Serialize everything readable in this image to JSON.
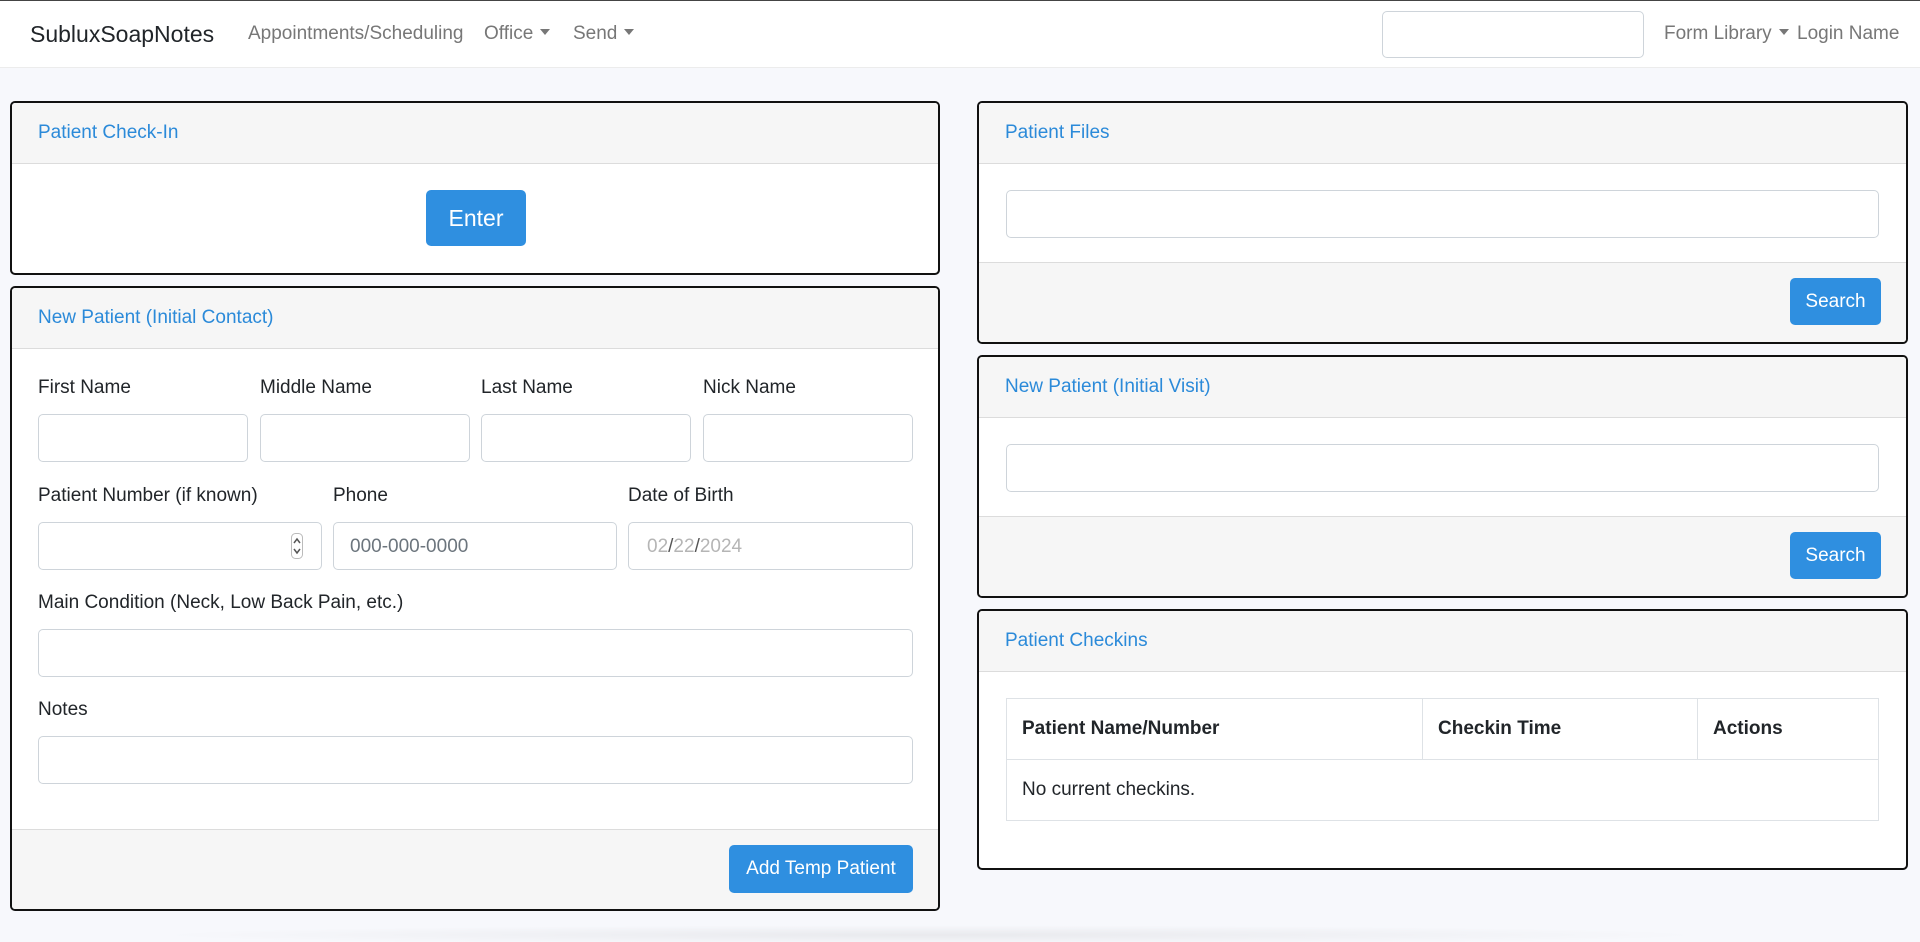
{
  "navbar": {
    "brand": "SubluxSoapNotes",
    "links": {
      "appointments": "Appointments/Scheduling",
      "office": "Office",
      "send": "Send",
      "form_library": "Form Library",
      "login": "Login Name"
    },
    "search_value": ""
  },
  "checkin_card": {
    "title": "Patient Check-In",
    "enter_button": "Enter"
  },
  "new_patient_contact": {
    "title": "New Patient (Initial Contact)",
    "fields": {
      "first_name": "First Name",
      "middle_name": "Middle Name",
      "last_name": "Last Name",
      "nick_name": "Nick Name",
      "patient_number": "Patient Number (if known)",
      "phone": "Phone",
      "phone_placeholder": "000-000-0000",
      "dob": "Date of Birth",
      "dob_month": "02",
      "dob_day": "22",
      "dob_year": "2024",
      "main_condition": "Main Condition (Neck, Low Back Pain, etc.)",
      "notes": "Notes"
    },
    "submit_button": "Add Temp Patient"
  },
  "patient_files": {
    "title": "Patient Files",
    "search_button": "Search"
  },
  "new_patient_visit": {
    "title": "New Patient (Initial Visit)",
    "search_button": "Search"
  },
  "patient_checkins": {
    "title": "Patient Checkins",
    "columns": [
      "Patient Name/Number",
      "Checkin Time",
      "Actions"
    ],
    "empty_message": "No current checkins."
  },
  "colors": {
    "accent": "#2f8fe0",
    "card_title": "#2b8ad9",
    "background": "#f7f8fc"
  }
}
